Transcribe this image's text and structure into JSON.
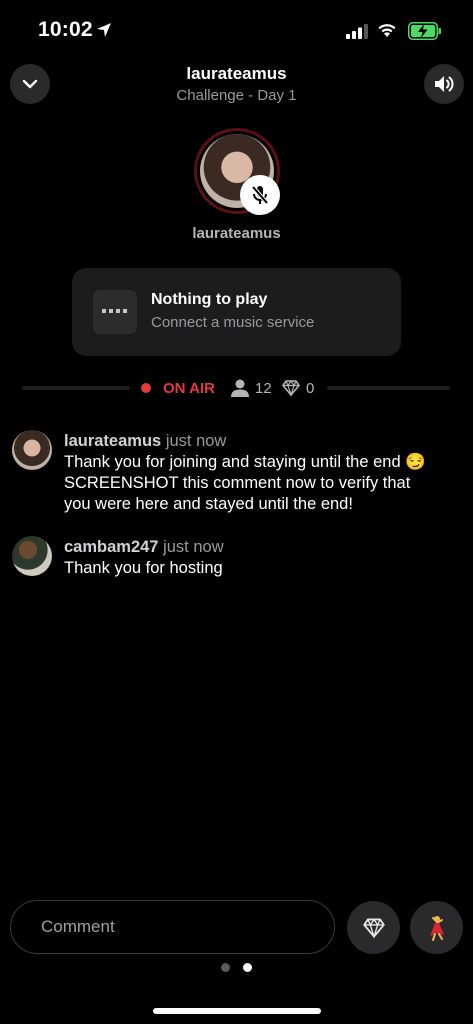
{
  "status_bar": {
    "time": "10:02"
  },
  "header": {
    "title": "laurateamus",
    "subtitle": "Challenge - Day 1"
  },
  "host": {
    "name": "laurateamus"
  },
  "music": {
    "title": "Nothing to play",
    "subtitle": "Connect a music service"
  },
  "on_air": {
    "label": "ON AIR",
    "listeners": "12",
    "gems": "0"
  },
  "comments": [
    {
      "user": "laurateamus",
      "time": "just now",
      "lines": [
        "Thank you for joining and staying until the end 😏",
        "SCREENSHOT this comment now to verify that",
        "you were here and stayed until the end!"
      ]
    },
    {
      "user": "cambam247",
      "time": "just now",
      "lines": [
        "Thank you for hosting"
      ]
    }
  ],
  "composer": {
    "placeholder": "Comment"
  },
  "pagination": {
    "current": 2,
    "total": 2
  },
  "colors": {
    "accent_red": "#e23b3b",
    "battery_green": "#4cd964"
  }
}
